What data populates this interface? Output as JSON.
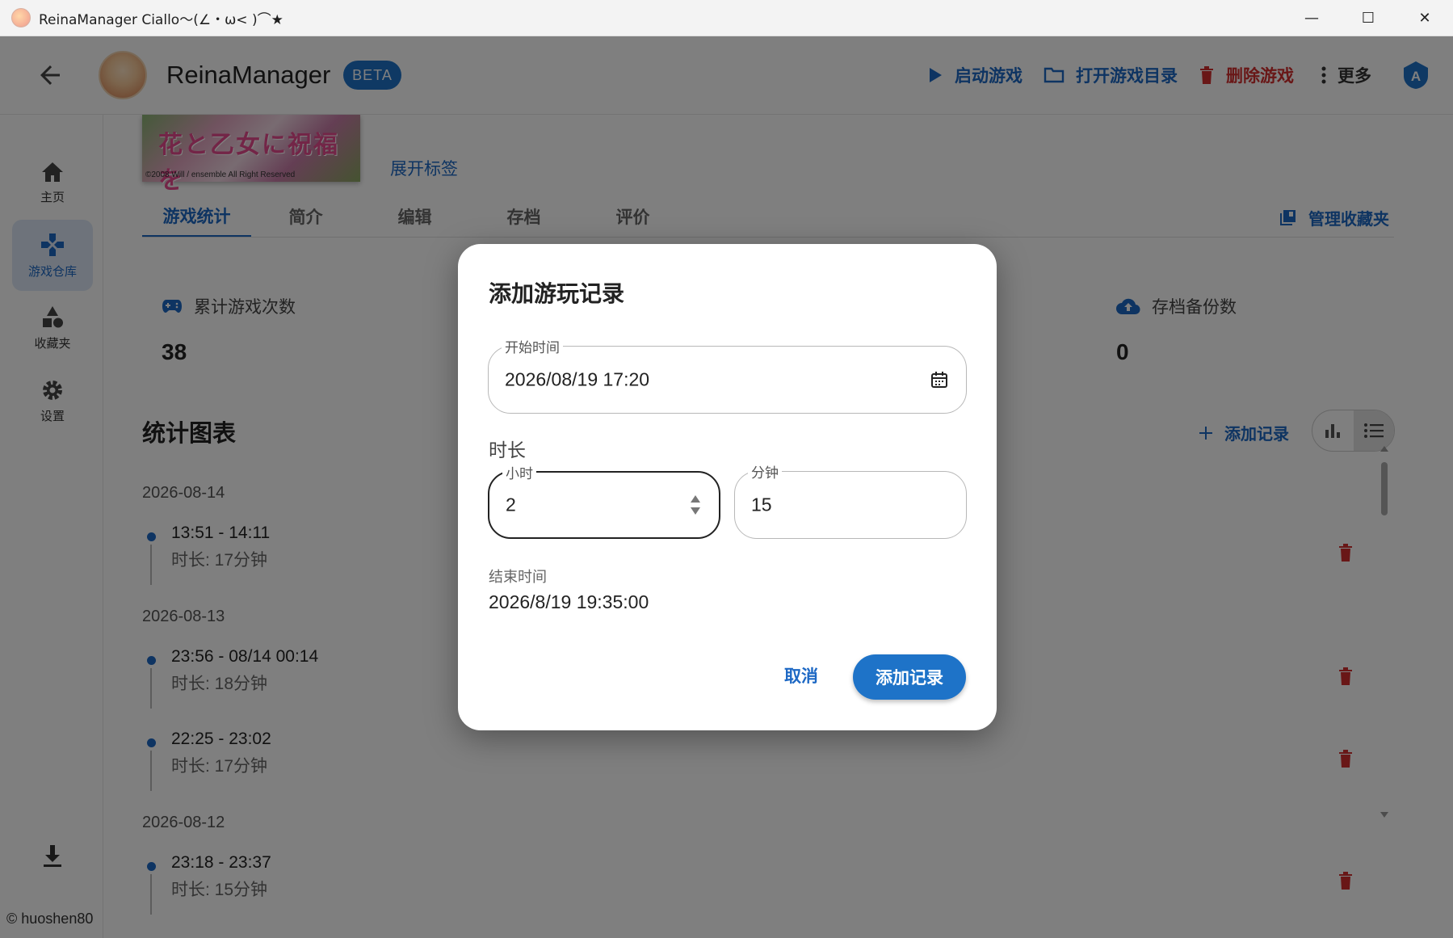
{
  "window": {
    "title": "ReinaManager Ciallo～(∠・ω< )⌒★"
  },
  "appbar": {
    "app_name": "ReinaManager",
    "badge": "BETA",
    "actions": {
      "launch": "启动游戏",
      "open_dir": "打开游戏目录",
      "delete": "删除游戏",
      "more": "更多"
    },
    "account_initial": "A"
  },
  "rail": {
    "items": [
      {
        "label": "主页",
        "icon": "home-icon"
      },
      {
        "label": "游戏仓库",
        "icon": "gamepad-icon",
        "active": true
      },
      {
        "label": "收藏夹",
        "icon": "shapes-icon"
      },
      {
        "label": "设置",
        "icon": "gear-icon"
      }
    ],
    "copyright": "© huoshen80"
  },
  "game": {
    "cover_title": "花と乙女に祝福を",
    "cover_copyright": "©2008 Will / ensemble All Right Reserved",
    "expand_tags": "展开标签"
  },
  "tabs": [
    "游戏统计",
    "简介",
    "编辑",
    "存档",
    "评价"
  ],
  "manage_collections": "管理收藏夹",
  "stats": [
    {
      "label": "累计游戏次数",
      "value": "38",
      "icon": "gamepad-icon"
    },
    {
      "label": "存档备份数",
      "value": "0",
      "icon": "cloud-upload-icon"
    }
  ],
  "chart_section": {
    "title": "统计图表",
    "add_record": "添加记录"
  },
  "timeline": [
    {
      "date": "2026-08-14",
      "time": "13:51 - 14:11",
      "duration": "时长: 17分钟"
    },
    {
      "date": "2026-08-13",
      "time": "23:56 - 08/14 00:14",
      "duration": "时长: 18分钟"
    },
    {
      "date": "",
      "time": "22:25 - 23:02",
      "duration": "时长: 17分钟"
    },
    {
      "date": "2026-08-12",
      "time": "23:18 - 23:37",
      "duration": "时长: 15分钟"
    }
  ],
  "dialog": {
    "title": "添加游玩记录",
    "start_label": "开始时间",
    "start_value": "2026/08/19 17:20",
    "duration_label": "时长",
    "hours_label": "小时",
    "hours_value": "2",
    "minutes_label": "分钟",
    "minutes_value": "15",
    "end_label": "结束时间",
    "end_value": "2026/8/19 19:35:00",
    "cancel": "取消",
    "submit": "添加记录"
  },
  "colors": {
    "primary": "#1e73c8",
    "danger": "#d32f2f",
    "scrim": "rgba(0,0,0,0.5)"
  }
}
